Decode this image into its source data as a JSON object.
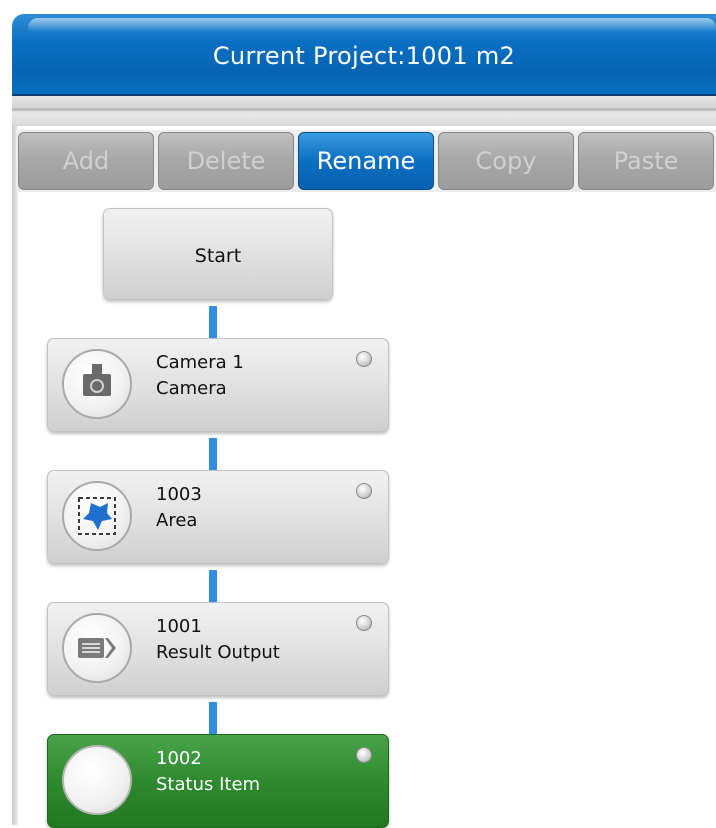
{
  "header": {
    "title": "Current Project:1001   m2"
  },
  "toolbar": {
    "buttons": [
      {
        "label": "Add",
        "enabled": false
      },
      {
        "label": "Delete",
        "enabled": false
      },
      {
        "label": "Rename",
        "enabled": true,
        "active": true
      },
      {
        "label": "Copy",
        "enabled": false
      },
      {
        "label": "Paste",
        "enabled": false
      }
    ]
  },
  "flow": {
    "start": {
      "label": "Start"
    },
    "nodes": [
      {
        "line1": "Camera 1",
        "line2": "Camera",
        "icon": "camera-icon"
      },
      {
        "line1": "1003",
        "line2": "Area",
        "icon": "area-icon"
      },
      {
        "line1": "1001",
        "line2": "Result Output",
        "icon": "result-output-icon"
      },
      {
        "line1": "1002",
        "line2": "Status Item",
        "icon": "status-icon",
        "selected": true
      }
    ]
  },
  "colors": {
    "accent": "#0a6fc2",
    "connector": "#2f8ee0",
    "selected_node": "#2f8a2f"
  }
}
